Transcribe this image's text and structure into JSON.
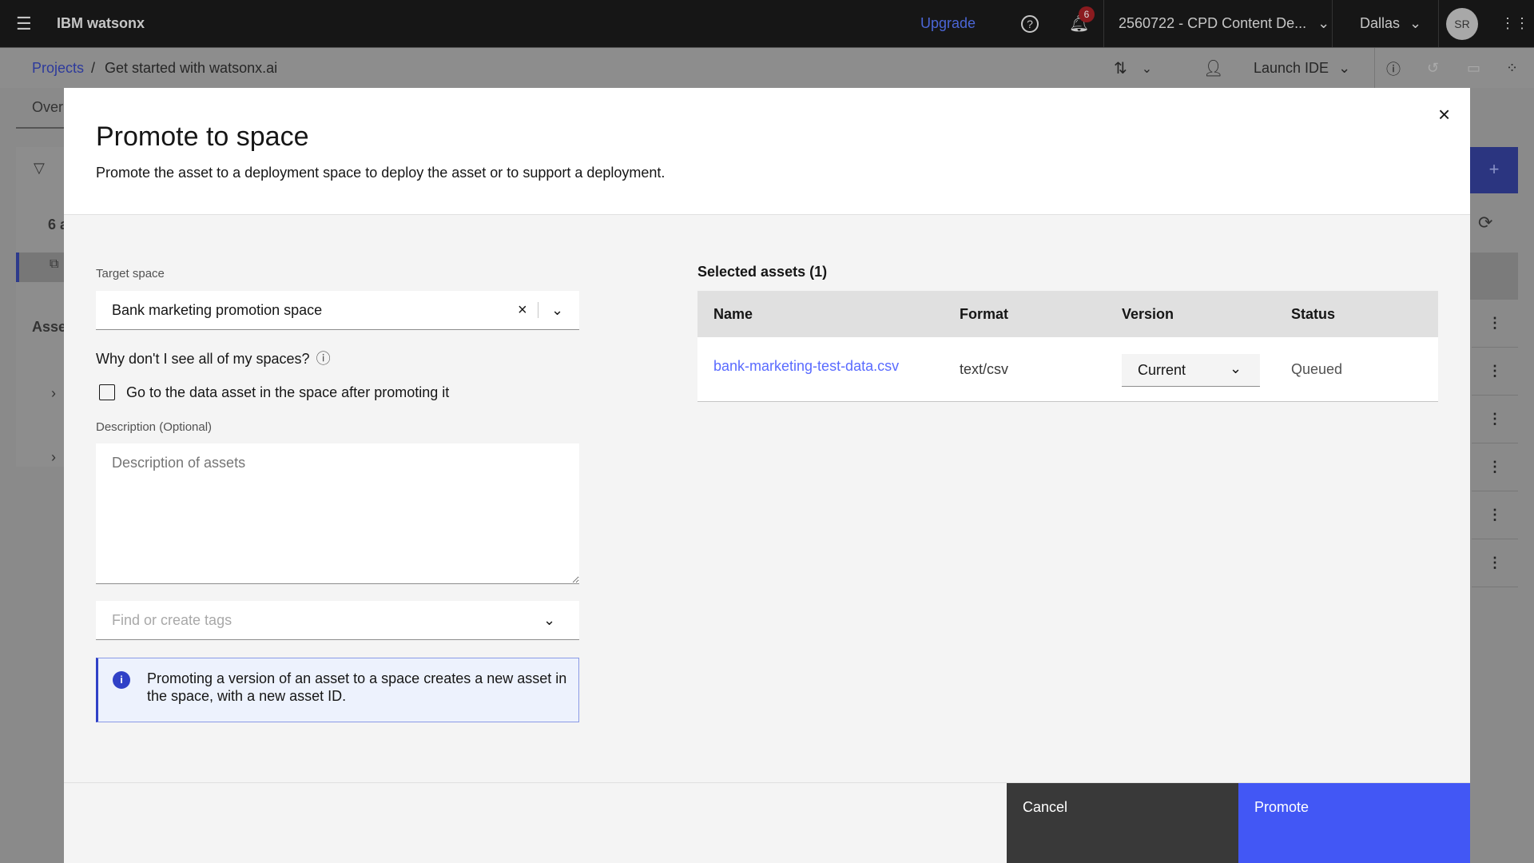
{
  "topbar": {
    "brand": "IBM watsonx",
    "upgrade": "Upgrade",
    "notification_count": "6",
    "account": "2560722 - CPD Content De...",
    "region": "Dallas",
    "avatar": "SR"
  },
  "breadcrumb": {
    "root": "Projects",
    "separator": "/",
    "current": "Get started with watsonx.ai",
    "launch_ide": "Launch IDE"
  },
  "background": {
    "tab_partial": "Over",
    "count_partial": "6 a",
    "section_partial": "Asse"
  },
  "modal": {
    "title": "Promote to space",
    "subtitle": "Promote the asset to a deployment space to deploy the asset or to support a deployment.",
    "target_space_label": "Target space",
    "target_space_value": "Bank marketing promotion space",
    "why_link": "Why don't I see all of my spaces?",
    "checkbox_label": "Go to the data asset in the space after promoting it",
    "checkbox_checked": false,
    "description_label": "Description (Optional)",
    "description_placeholder": "Description of assets",
    "tags_placeholder": "Find or create tags",
    "info_text": "Promoting a version of an asset to a space creates a new asset in the space, with a new asset ID.",
    "selected_title": "Selected assets (1)",
    "table": {
      "headers": [
        "Name",
        "Format",
        "Version",
        "Status"
      ],
      "rows": [
        {
          "name": "bank-marketing-test-data.csv",
          "format": "text/csv",
          "version": "Current",
          "status": "Queued"
        }
      ]
    },
    "cancel": "Cancel",
    "promote": "Promote"
  },
  "colors": {
    "accent": "#4257f5",
    "link": "#5a6bff",
    "topbar": "#161616",
    "footer_dark": "#393939"
  }
}
